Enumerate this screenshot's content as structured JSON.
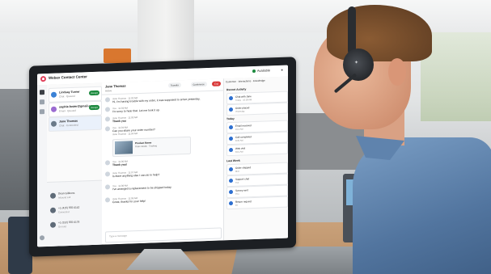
{
  "app": {
    "title": "Webex Contact Center",
    "availability": "Available"
  },
  "tasks": [
    {
      "name": "Lindsay Turner",
      "sub": "Chat · Queued",
      "action": "Accept",
      "color": "#3b82d6"
    },
    {
      "name": "sophie.foster@gmail.com",
      "sub": "Email · Queued",
      "action": "Accept",
      "color": "#9b6bd1"
    },
    {
      "name": "Jane Thomas",
      "sub": "Chat · Connected",
      "action": "",
      "color": "#6a7a8a"
    }
  ],
  "dock": [
    {
      "title": "Dean Gibbons",
      "sub": "Inbound call"
    },
    {
      "title": "+1 (415) 555-0142",
      "sub": "Connected"
    },
    {
      "title": "+1 (312) 555-0178",
      "sub": "On hold"
    }
  ],
  "chat": {
    "contact": "Jane Thomas",
    "status": "Active",
    "buttons": [
      "Transfer",
      "Conference",
      "End"
    ],
    "messages": [
      {
        "meta": "Jane Thomas · 11:02 AM",
        "text": "Hi, I'm having trouble with my order, it was supposed to arrive yesterday."
      },
      {
        "meta": "You · 11:03 AM",
        "text": "I'm sorry to hear that. Let me look it up."
      },
      {
        "meta": "Jane Thomas · 11:03 AM",
        "text": "Thank you",
        "bold": true
      },
      {
        "meta": "You · 11:04 AM",
        "text": "Can you share your order number?"
      },
      {
        "meta": "Jane Thomas · 11:04 AM",
        "text": "Here is the product I ordered"
      },
      {
        "meta": "You · 11:06 AM",
        "text": "Thank you!",
        "bold": true
      },
      {
        "meta": "Jane Thomas · 11:07 AM",
        "text": "Is there anything else I can do to help?"
      },
      {
        "meta": "You · 11:08 AM",
        "text": "I've arranged a replacement to be shipped today."
      },
      {
        "meta": "Jane Thomas · 11:09 AM",
        "text": "Great, thanks for your help!"
      }
    ],
    "card": {
      "title": "Product Name",
      "sub": "Order details · Tracking"
    },
    "compose_placeholder": "Type a message"
  },
  "right_panel": {
    "tabs": [
      "Customer",
      "Interactions",
      "Knowledge"
    ],
    "sections": [
      {
        "title": "Recent Activity",
        "items": [
          {
            "t": "Chat with Jane",
            "s": "Today · 10:58 AM"
          },
          {
            "t": "Order placed",
            "s": "Yesterday"
          }
        ]
      },
      {
        "title": "Today",
        "items": [
          {
            "t": "Email received",
            "s": "9:12 AM"
          },
          {
            "t": "Call completed",
            "s": "8:40 AM"
          },
          {
            "t": "Web visit",
            "s": "8:15 AM"
          }
        ]
      },
      {
        "title": "Last Week",
        "items": [
          {
            "t": "Order shipped",
            "s": "Mon"
          },
          {
            "t": "Support chat",
            "s": "Tue"
          },
          {
            "t": "Survey sent",
            "s": "Thu"
          },
          {
            "t": "Return request",
            "s": "Fri"
          }
        ]
      }
    ]
  }
}
